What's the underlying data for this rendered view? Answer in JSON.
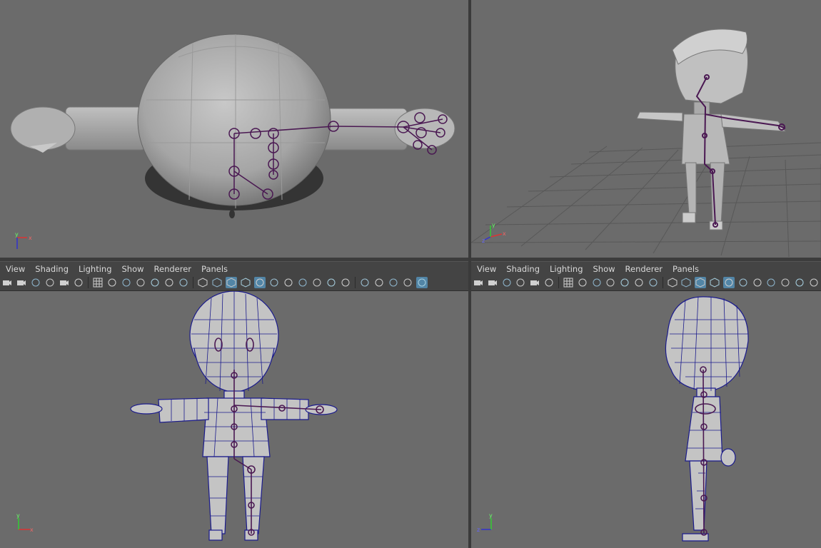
{
  "viewports": [
    {
      "id": "top",
      "view": "top"
    },
    {
      "id": "persp",
      "view": "perspective"
    },
    {
      "id": "front",
      "view": "front"
    },
    {
      "id": "side",
      "view": "side"
    }
  ],
  "panel_menu": {
    "left": [
      "View",
      "Shading",
      "Lighting",
      "Show",
      "Renderer",
      "Panels"
    ],
    "right": [
      "View",
      "Shading",
      "Lighting",
      "Show",
      "Renderer",
      "Panels"
    ]
  },
  "toolbar_icons": [
    "camera-icon",
    "camera-attr-icon",
    "bookmark-icon",
    "grease-pencil-icon",
    "move-camera-icon",
    "pen-icon",
    "grid-icon",
    "film-gate-icon",
    "resolution-gate-icon",
    "gate-mask-icon",
    "field-chart-icon",
    "safe-action-icon",
    "safe-title-icon",
    "wireframe-icon",
    "smooth-shade-icon",
    "default-material-icon",
    "wireframe-on-shaded-icon",
    "xray-icon",
    "use-lights-icon",
    "shadows-icon",
    "screen-space-ao-icon",
    "motion-blur-icon",
    "multisample-icon",
    "depth-of-field-icon",
    "isolate-select-icon",
    "xray-joints-icon",
    "xray-active-icon",
    "backface-icon",
    "viewport-icon"
  ],
  "axis_labels": {
    "x": "x",
    "y": "y",
    "z": "z"
  },
  "colors": {
    "viewport_bg": "#6b6b6b",
    "mesh_shaded": "#b5b5b5",
    "wire": "#1b1b8c",
    "joint": "#4a1852",
    "active_icon_bg": "#5285a6"
  }
}
